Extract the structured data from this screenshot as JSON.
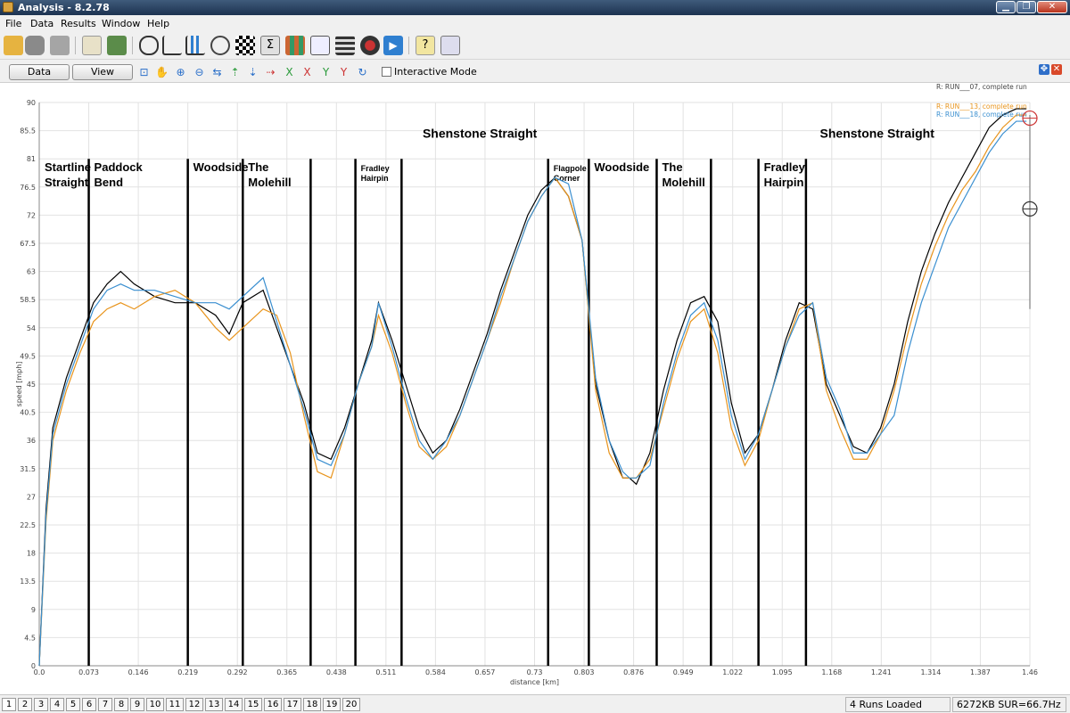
{
  "window": {
    "title": "Analysis - 8.2.78"
  },
  "menu": [
    "File",
    "Data",
    "Results",
    "Window",
    "Help"
  ],
  "toolbar": {
    "icons": [
      "open-folder-icon",
      "database-icon",
      "print-icon",
      "clipboard-icon",
      "spreadsheet-icon",
      "track-map-icon",
      "line-chart-icon",
      "bar-chart-icon",
      "stopwatch-icon",
      "checkered-flag-icon",
      "sigma-icon",
      "grid-icon",
      "graph-icon",
      "film-icon",
      "gauge-icon",
      "play-icon",
      "help-icon",
      "report-icon"
    ]
  },
  "toolbar2": {
    "data_options": "Data options",
    "view_options": "View options",
    "tools": [
      "zoom-window-icon",
      "zoom-hand-icon",
      "zoom-in-icon",
      "zoom-out-icon",
      "pan-horizontal-icon",
      "arrow-up-icon",
      "arrow-down-icon",
      "arrow-right-icon",
      "x-axis-icon",
      "x-axis-alt-icon",
      "y-axis-icon",
      "y-axis-alt-icon",
      "refresh-icon"
    ],
    "interactive_mode": "Interactive Mode"
  },
  "chart_data": {
    "type": "line",
    "xlabel": "distance [km]",
    "ylabel": "speed [mph]",
    "xlim": [
      0,
      1.46
    ],
    "ylim": [
      0,
      90
    ],
    "x_ticks": [
      "0.0",
      "0.073",
      "0.146",
      "0.219",
      "0.292",
      "0.365",
      "0.438",
      "0.511",
      "0.584",
      "0.657",
      "0.73",
      "0.803",
      "0.876",
      "0.949",
      "1.022",
      "1.095",
      "1.168",
      "1.241",
      "1.314",
      "1.387",
      "1.46"
    ],
    "y_ticks": [
      "0",
      "4.5",
      "9",
      "13.5",
      "18",
      "22.5",
      "27",
      "31.5",
      "36",
      "40.5",
      "45",
      "49.5",
      "54",
      "58.5",
      "63",
      "67.5",
      "72",
      "76.5",
      "81",
      "85.5",
      "90"
    ],
    "grid": true,
    "legend_position": "top-right",
    "series": [
      {
        "name": "R:  RUN___07, complete run",
        "color": "#000000",
        "x": [
          0,
          0.01,
          0.02,
          0.04,
          0.06,
          0.08,
          0.1,
          0.12,
          0.14,
          0.17,
          0.2,
          0.23,
          0.26,
          0.28,
          0.3,
          0.33,
          0.35,
          0.37,
          0.39,
          0.41,
          0.43,
          0.45,
          0.47,
          0.49,
          0.5,
          0.52,
          0.54,
          0.56,
          0.58,
          0.6,
          0.62,
          0.64,
          0.66,
          0.68,
          0.7,
          0.72,
          0.74,
          0.76,
          0.78,
          0.8,
          0.82,
          0.84,
          0.86,
          0.87,
          0.88,
          0.9,
          0.92,
          0.94,
          0.96,
          0.98,
          1.0,
          1.02,
          1.04,
          1.06,
          1.08,
          1.1,
          1.12,
          1.14,
          1.16,
          1.18,
          1.2,
          1.22,
          1.24,
          1.26,
          1.28,
          1.3,
          1.32,
          1.34,
          1.36,
          1.38,
          1.4,
          1.42,
          1.44,
          1.455
        ],
        "y": [
          0,
          25,
          38,
          46,
          52,
          58,
          61,
          63,
          61,
          59,
          58,
          58,
          56,
          53,
          58,
          60,
          54,
          48,
          42,
          34,
          33,
          38,
          45,
          52,
          58,
          52,
          45,
          38,
          34,
          36,
          41,
          47,
          53,
          60,
          66,
          72,
          76,
          78,
          75,
          68,
          45,
          36,
          30,
          30,
          29,
          34,
          44,
          52,
          58,
          59,
          55,
          42,
          34,
          37,
          44,
          52,
          58,
          57,
          45,
          40,
          35,
          34,
          38,
          45,
          55,
          63,
          69,
          74,
          78,
          82,
          86,
          88,
          89,
          89
        ]
      },
      {
        "name": "R:  RUN___13, complete run",
        "color": "#e8941c",
        "x": [
          0,
          0.01,
          0.02,
          0.04,
          0.06,
          0.08,
          0.1,
          0.12,
          0.14,
          0.17,
          0.2,
          0.23,
          0.26,
          0.28,
          0.3,
          0.33,
          0.35,
          0.37,
          0.39,
          0.41,
          0.43,
          0.45,
          0.47,
          0.49,
          0.5,
          0.52,
          0.54,
          0.56,
          0.58,
          0.6,
          0.62,
          0.64,
          0.66,
          0.68,
          0.7,
          0.72,
          0.74,
          0.76,
          0.78,
          0.8,
          0.82,
          0.84,
          0.86,
          0.87,
          0.88,
          0.9,
          0.92,
          0.94,
          0.96,
          0.98,
          1.0,
          1.02,
          1.04,
          1.06,
          1.08,
          1.1,
          1.12,
          1.14,
          1.16,
          1.18,
          1.2,
          1.22,
          1.24,
          1.26,
          1.28,
          1.3,
          1.32,
          1.34,
          1.36,
          1.38,
          1.4,
          1.42,
          1.44,
          1.455
        ],
        "y": [
          0,
          23,
          36,
          44,
          50,
          55,
          57,
          58,
          57,
          59,
          60,
          58,
          54,
          52,
          54,
          57,
          56,
          50,
          40,
          31,
          30,
          37,
          45,
          51,
          56,
          50,
          42,
          35,
          33,
          35,
          40,
          46,
          52,
          58,
          65,
          71,
          75,
          78,
          75,
          68,
          44,
          34,
          30,
          30,
          30,
          33,
          41,
          49,
          55,
          57,
          50,
          38,
          32,
          36,
          44,
          51,
          57,
          58,
          44,
          38,
          33,
          33,
          37,
          44,
          53,
          61,
          67,
          72,
          76,
          79,
          83,
          86,
          88,
          88
        ]
      },
      {
        "name": "R:  RUN___18, complete run",
        "color": "#3a8fd0",
        "x": [
          0,
          0.01,
          0.02,
          0.04,
          0.06,
          0.08,
          0.1,
          0.12,
          0.14,
          0.17,
          0.2,
          0.23,
          0.26,
          0.28,
          0.3,
          0.33,
          0.35,
          0.37,
          0.39,
          0.41,
          0.43,
          0.45,
          0.47,
          0.49,
          0.5,
          0.52,
          0.54,
          0.56,
          0.58,
          0.6,
          0.62,
          0.64,
          0.66,
          0.68,
          0.7,
          0.72,
          0.74,
          0.76,
          0.78,
          0.8,
          0.82,
          0.84,
          0.86,
          0.87,
          0.88,
          0.9,
          0.92,
          0.94,
          0.96,
          0.98,
          1.0,
          1.02,
          1.04,
          1.06,
          1.08,
          1.1,
          1.12,
          1.14,
          1.16,
          1.18,
          1.2,
          1.22,
          1.24,
          1.26,
          1.28,
          1.3,
          1.32,
          1.34,
          1.36,
          1.38,
          1.4,
          1.42,
          1.44,
          1.455
        ],
        "y": [
          0,
          24,
          37,
          45,
          51,
          57,
          60,
          61,
          60,
          60,
          59,
          58,
          58,
          57,
          59,
          62,
          55,
          48,
          41,
          33,
          32,
          37,
          45,
          51,
          58,
          51,
          43,
          36,
          33,
          36,
          40,
          46,
          52,
          59,
          65,
          71,
          75,
          78,
          77,
          68,
          46,
          36,
          31,
          30,
          30,
          32,
          42,
          50,
          56,
          58,
          52,
          40,
          33,
          37,
          44,
          51,
          56,
          58,
          46,
          41,
          34,
          34,
          37,
          40,
          50,
          58,
          64,
          70,
          74,
          78,
          82,
          85,
          87,
          87
        ]
      }
    ],
    "annotations": [
      {
        "x": 0.0,
        "label": "Startline\nStraight"
      },
      {
        "x": 0.073,
        "label": "Paddock\nBend"
      },
      {
        "x": 0.219,
        "label": "Woodside"
      },
      {
        "x": 0.3,
        "label": "The\nMolehill"
      },
      {
        "x": 0.4,
        "label": ""
      },
      {
        "x": 0.466,
        "label": "Fradley\nHairpin"
      },
      {
        "x": 0.534,
        "label": ""
      },
      {
        "x": 0.75,
        "label": "Flagpole\nCorner"
      },
      {
        "x": 0.81,
        "label": "Woodside"
      },
      {
        "x": 0.91,
        "label": "The\nMolehill"
      },
      {
        "x": 0.99,
        "label": ""
      },
      {
        "x": 1.06,
        "label": "Fradley\nHairpin"
      },
      {
        "x": 1.13,
        "label": ""
      }
    ],
    "top_labels": [
      {
        "x": 0.565,
        "label": "Shenstone Straight"
      },
      {
        "x": 1.19,
        "label": "Shenstone Straight"
      }
    ]
  },
  "status": {
    "tabs": [
      "1",
      "2",
      "3",
      "4",
      "5",
      "6",
      "7",
      "8",
      "9",
      "10",
      "11",
      "12",
      "13",
      "14",
      "15",
      "16",
      "17",
      "18",
      "19",
      "20"
    ],
    "runs_loaded": "4 Runs Loaded",
    "memory": "6272KB SUR=66.7Hz"
  }
}
